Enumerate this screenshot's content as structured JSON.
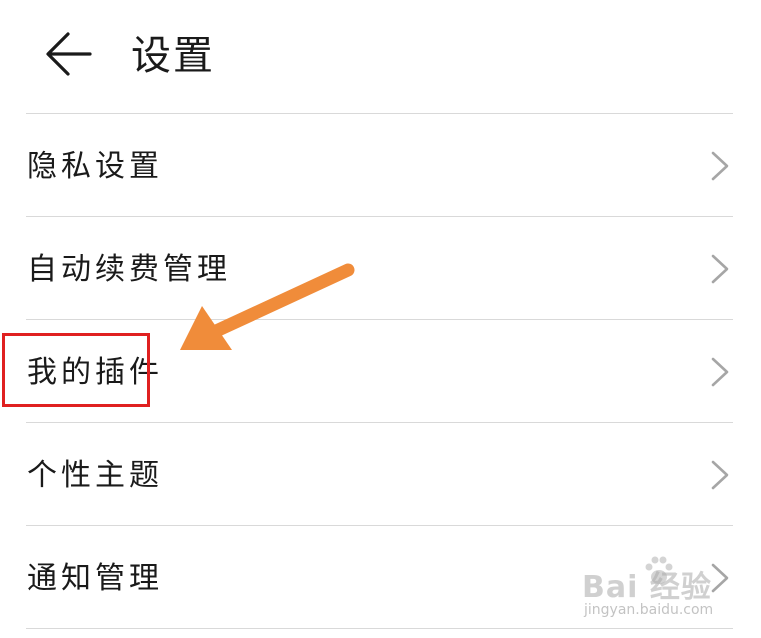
{
  "header": {
    "back_icon": "arrow-left-icon",
    "title": "设置"
  },
  "settings": {
    "items": [
      {
        "label": "隐私设置",
        "icon": "chevron-right-icon"
      },
      {
        "label": "自动续费管理",
        "icon": "chevron-right-icon"
      },
      {
        "label": "我的插件",
        "icon": "chevron-right-icon"
      },
      {
        "label": "个性主题",
        "icon": "chevron-right-icon"
      },
      {
        "label": "通知管理",
        "icon": "chevron-right-icon"
      }
    ]
  },
  "annotation": {
    "highlight_color": "#e02020",
    "arrow_color": "#f08c3a"
  },
  "watermark": {
    "brand": "Bai  经验",
    "site": "jingyan.baidu.com"
  },
  "colors": {
    "text": "#1a1a1a",
    "divider": "#d9d9d9",
    "chevron": "#a6a6a6"
  }
}
